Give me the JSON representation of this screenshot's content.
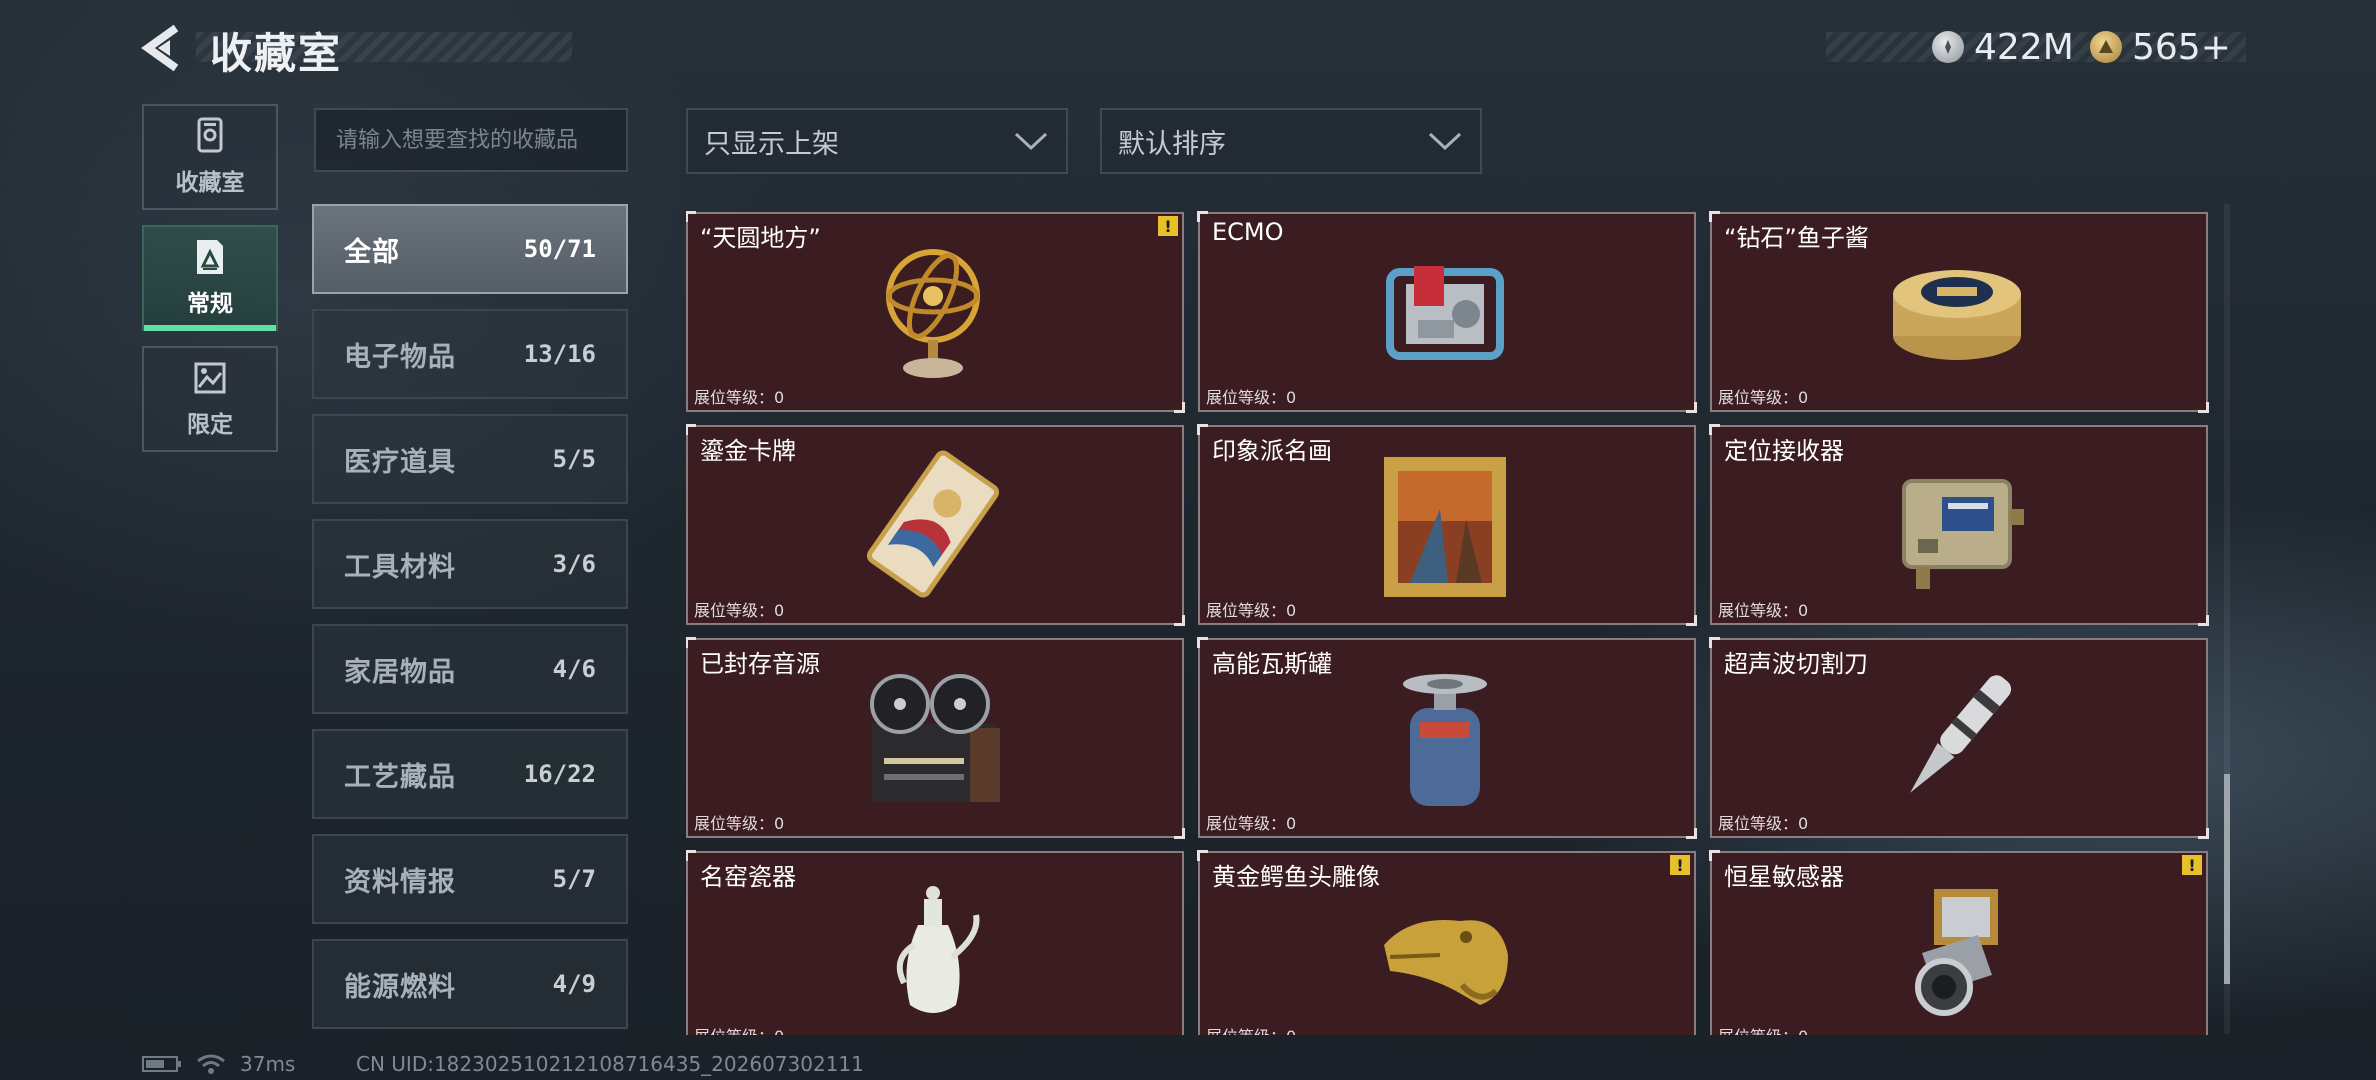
{
  "header": {
    "title": "收藏室",
    "currencies": [
      {
        "icon": "silver-coin-icon",
        "value": "422M"
      },
      {
        "icon": "gold-coin-icon",
        "value": "565+"
      }
    ]
  },
  "mode_tabs": [
    {
      "label": "收藏室",
      "icon": "collection-room-icon",
      "active": false
    },
    {
      "label": "常规",
      "icon": "regular-document-icon",
      "active": true
    },
    {
      "label": "限定",
      "icon": "limited-image-icon",
      "active": false
    }
  ],
  "search": {
    "placeholder": "请输入想要查找的收藏品",
    "value": ""
  },
  "categories": [
    {
      "name": "全部",
      "count": "50/71",
      "active": true
    },
    {
      "name": "电子物品",
      "count": "13/16"
    },
    {
      "name": "医疗道具",
      "count": "5/5"
    },
    {
      "name": "工具材料",
      "count": "3/6"
    },
    {
      "name": "家居物品",
      "count": "4/6"
    },
    {
      "name": "工艺藏品",
      "count": "16/22"
    },
    {
      "name": "资料情报",
      "count": "5/7"
    },
    {
      "name": "能源燃料",
      "count": "4/9"
    }
  ],
  "filters": {
    "listing": "只显示上架",
    "sort": "默认排序"
  },
  "level_label": "展位等级：0",
  "items": [
    {
      "name": "“天圆地方”",
      "icon": "armillary-sphere-icon",
      "warning": true
    },
    {
      "name": "ECMO",
      "icon": "ecmo-machine-icon",
      "warning": false
    },
    {
      "name": "“钻石”鱼子酱",
      "icon": "caviar-tin-icon",
      "warning": false
    },
    {
      "name": "鎏金卡牌",
      "icon": "gilded-card-icon",
      "warning": false
    },
    {
      "name": "印象派名画",
      "icon": "framed-painting-icon",
      "warning": false
    },
    {
      "name": "定位接收器",
      "icon": "locator-receiver-icon",
      "warning": false
    },
    {
      "name": "已封存音源",
      "icon": "reel-tape-recorder-icon",
      "warning": false
    },
    {
      "name": "高能瓦斯罐",
      "icon": "gas-canister-icon",
      "warning": false
    },
    {
      "name": "超声波切割刀",
      "icon": "ultrasonic-cutter-icon",
      "warning": false
    },
    {
      "name": "名窑瓷器",
      "icon": "porcelain-ewer-icon",
      "warning": false
    },
    {
      "name": "黄金鳄鱼头雕像",
      "icon": "golden-crocodile-statue-icon",
      "warning": true
    },
    {
      "name": "恒星敏感器",
      "icon": "star-sensor-icon",
      "warning": true
    }
  ],
  "warning_mark": "!",
  "footer": {
    "ping": "37ms",
    "uid": "CN UID:18230251021210871643​5_202607302111"
  },
  "colors": {
    "accent": "#5fe0a6",
    "card_bg": "#3a1c21",
    "warning": "#e8c12a"
  }
}
